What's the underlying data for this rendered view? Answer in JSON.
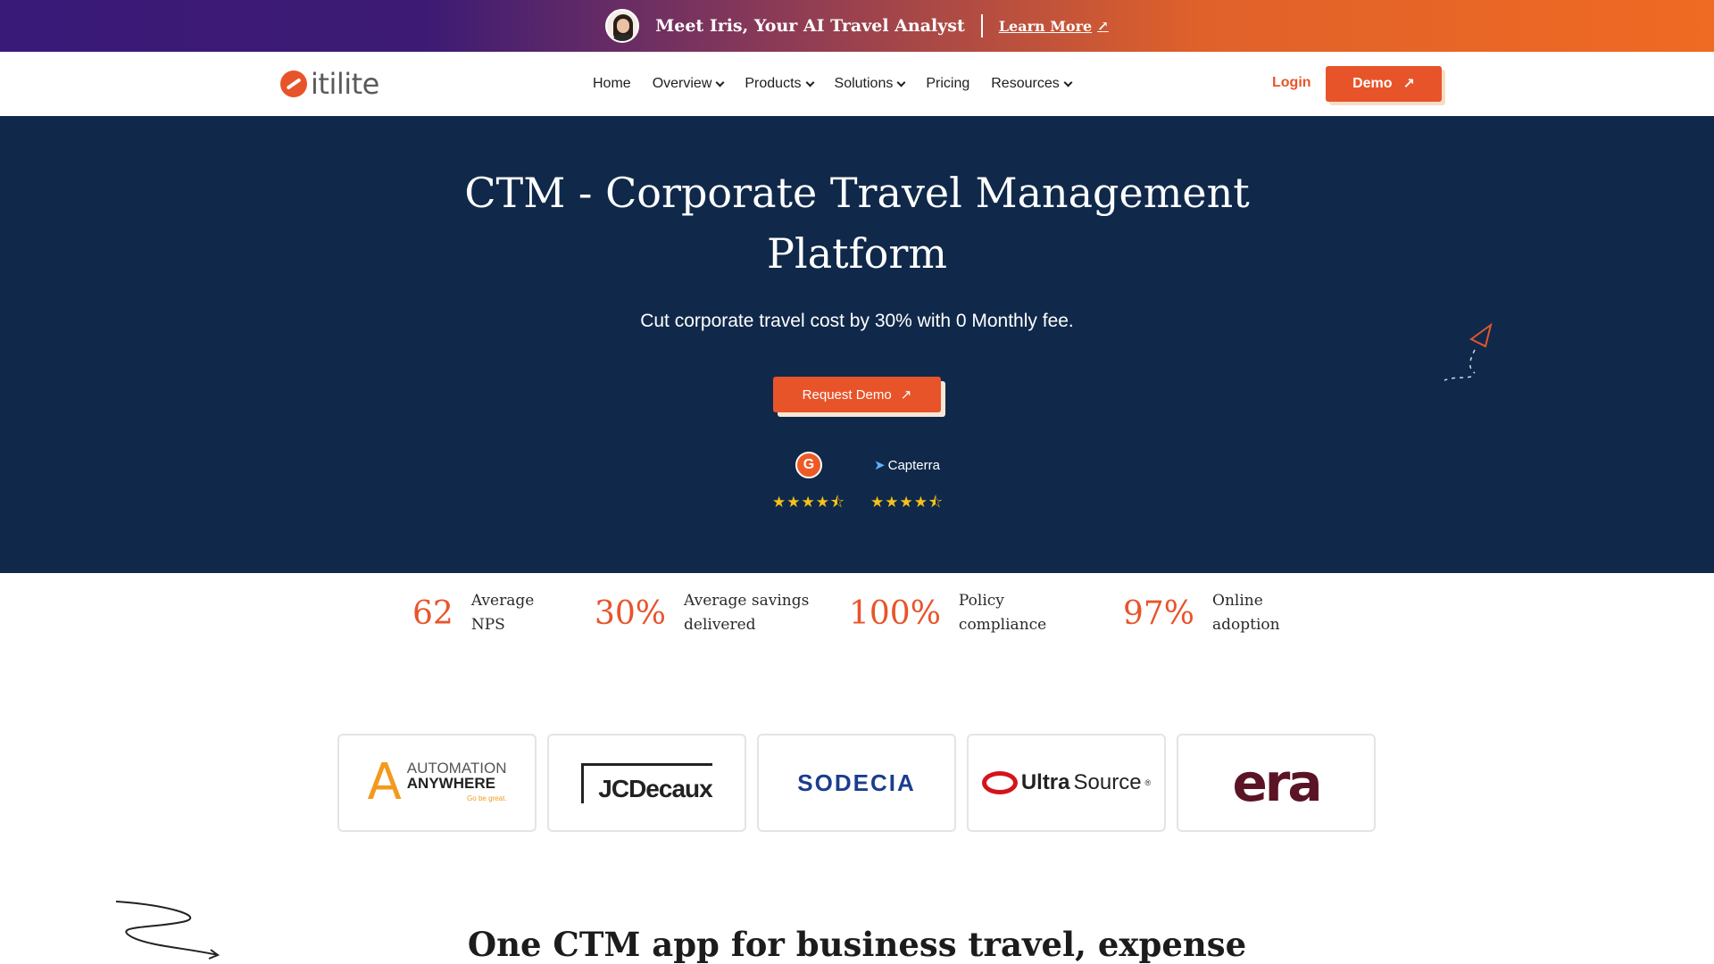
{
  "announcement": {
    "title": "Meet Iris, Your AI Travel Analyst",
    "link_label": "Learn More",
    "link_icon": "arrow-up-right-icon"
  },
  "nav": {
    "brand": "itilite",
    "items": [
      {
        "label": "Home",
        "dropdown": false
      },
      {
        "label": "Overview",
        "dropdown": true
      },
      {
        "label": "Products",
        "dropdown": true
      },
      {
        "label": "Solutions",
        "dropdown": true
      },
      {
        "label": "Pricing",
        "dropdown": false
      },
      {
        "label": "Resources",
        "dropdown": true
      }
    ],
    "login_label": "Login",
    "demo_label": "Demo"
  },
  "hero": {
    "title_line1": "CTM - Corporate Travel Management",
    "title_line2": "Platform",
    "subtitle": "Cut corporate travel cost by 30% with 0 Monthly fee.",
    "cta_label": "Request Demo",
    "ratings": [
      {
        "source": "G2",
        "badge": "G",
        "stars": 4.5
      },
      {
        "source": "Capterra",
        "stars": 4.5
      }
    ]
  },
  "stats": [
    {
      "value": "62",
      "label_line1": "Average",
      "label_line2": "NPS"
    },
    {
      "value": "30%",
      "label_line1": "Average savings",
      "label_line2": "delivered"
    },
    {
      "value": "100%",
      "label_line1": "Policy",
      "label_line2": "compliance"
    },
    {
      "value": "97%",
      "label_line1": "Online",
      "label_line2": "adoption"
    }
  ],
  "clients": {
    "automation_anywhere": {
      "line1": "AUTOMATION",
      "line2": "ANYWHERE",
      "tagline": "Go be great."
    },
    "jcdecaux": "JCDecaux",
    "sodecia": "SODECIA",
    "ultrasource": {
      "bold": "Ultra",
      "rest": "Source",
      "reg": "®"
    },
    "era": "era"
  },
  "section": {
    "heading": "One CTM app for business travel, expense"
  },
  "colors": {
    "accent": "#e8542a",
    "hero_bg": "#10294a",
    "star": "#f4c21b"
  }
}
